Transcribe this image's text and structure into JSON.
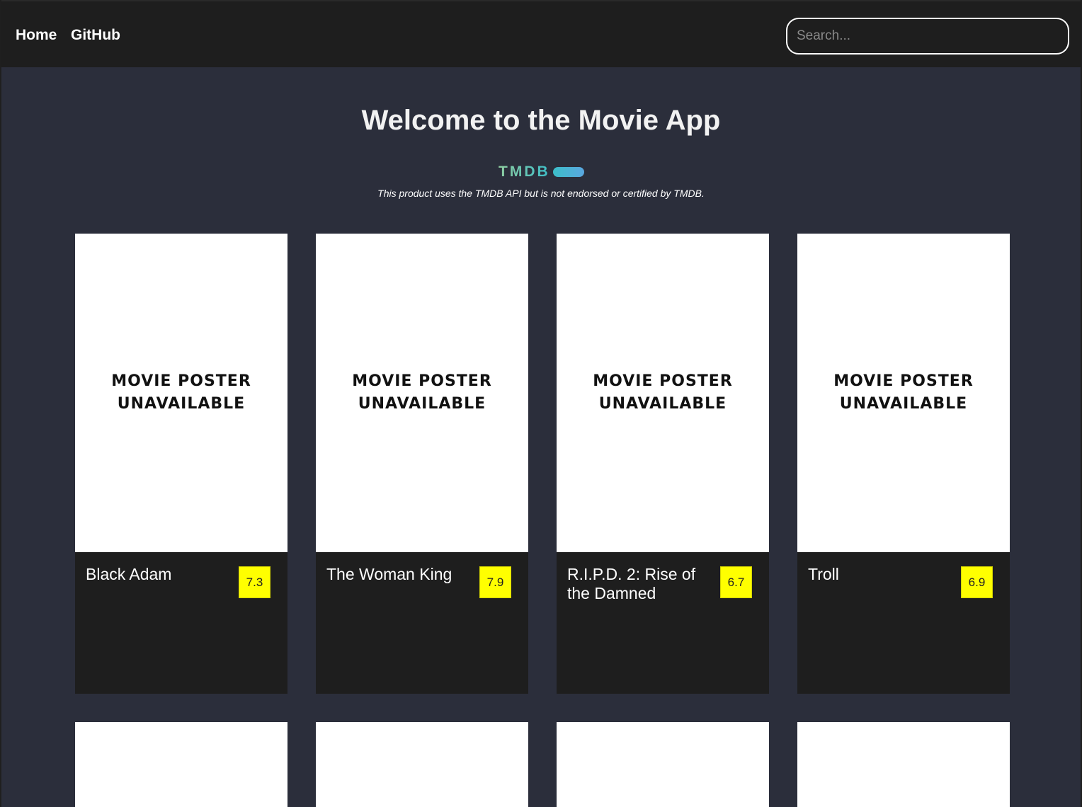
{
  "nav": {
    "home": "Home",
    "github": "GitHub",
    "search_placeholder": "Search..."
  },
  "hero": {
    "title": "Welcome to the Movie App",
    "logo_text": "TMDB",
    "disclaimer": "This product uses the TMDB API but is not endorsed or certified by TMDB."
  },
  "colors": {
    "header_bg": "#1e1e1e",
    "page_bg": "#2b2e3b",
    "rating_bg": "#ffff00",
    "tmdb_green": "#90cea1",
    "tmdb_blue": "#3cbec9"
  },
  "movies": [
    {
      "poster_text": "MOVIE POSTER UNAVAILABLE",
      "title": "Black Adam",
      "rating": "7.3"
    },
    {
      "poster_text": "MOVIE POSTER UNAVAILABLE",
      "title": "The Woman King",
      "rating": "7.9"
    },
    {
      "poster_text": "MOVIE POSTER UNAVAILABLE",
      "title": "R.I.P.D. 2: Rise of the Damned",
      "rating": "6.7"
    },
    {
      "poster_text": "MOVIE POSTER UNAVAILABLE",
      "title": "Troll",
      "rating": "6.9"
    }
  ]
}
